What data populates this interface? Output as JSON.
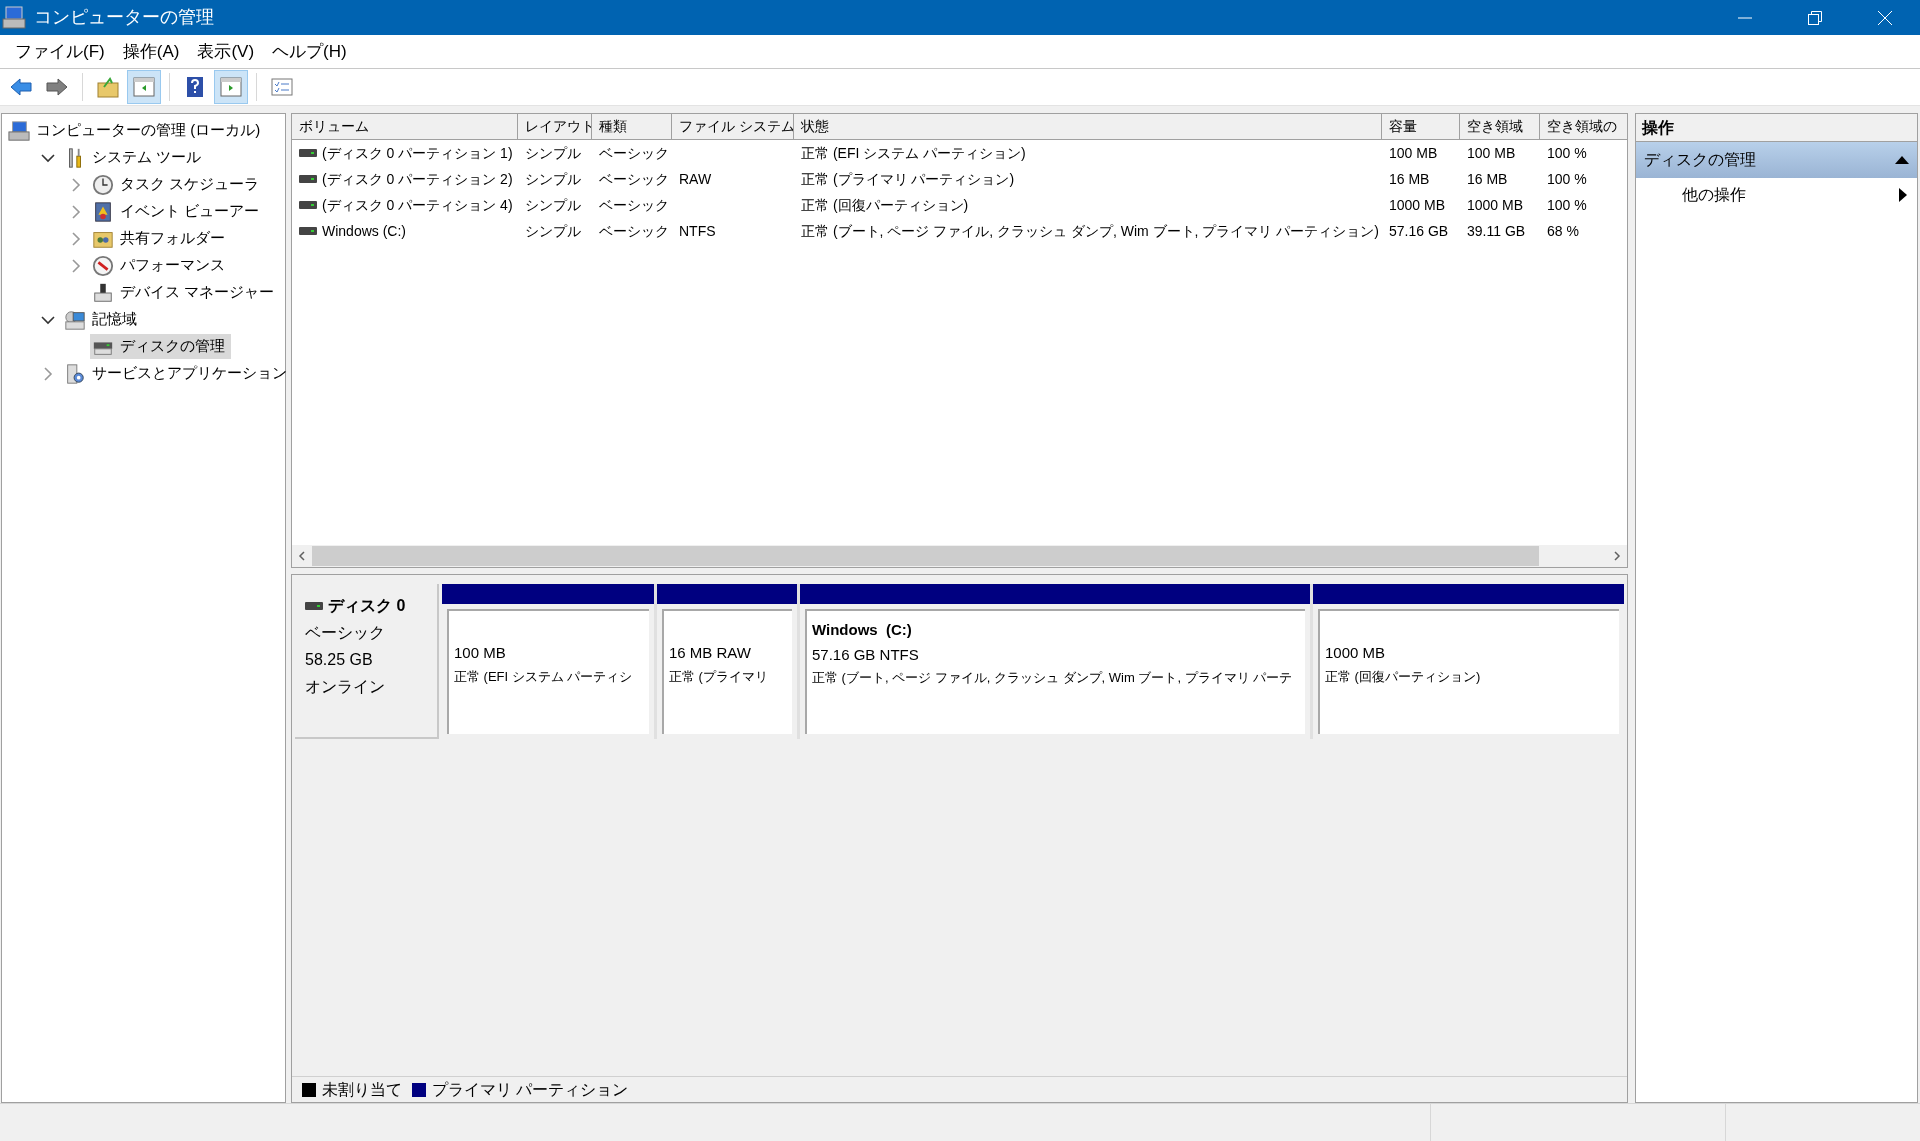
{
  "window": {
    "title": "コンピューターの管理"
  },
  "menu": [
    "ファイル(F)",
    "操作(A)",
    "表示(V)",
    "ヘルプ(H)"
  ],
  "toolbar": [
    {
      "kind": "back",
      "selected": false
    },
    {
      "kind": "forward",
      "selected": false
    },
    {
      "kind": "up",
      "selected": false
    },
    {
      "kind": "tree-pane",
      "selected": true
    },
    {
      "kind": "help",
      "selected": false
    },
    {
      "kind": "action-pane",
      "selected": true
    },
    {
      "kind": "list",
      "selected": false
    }
  ],
  "tree": [
    {
      "label": "コンピューターの管理 (ローカル)",
      "kind": "computer",
      "selected": false,
      "children": [
        {
          "label": "システム ツール",
          "kind": "tools",
          "expanded": true,
          "selected": false,
          "children": [
            {
              "label": "タスク スケジューラ",
              "kind": "clock",
              "expanded": false,
              "selected": false
            },
            {
              "label": "イベント ビューアー",
              "kind": "event",
              "expanded": false,
              "selected": false
            },
            {
              "label": "共有フォルダー",
              "kind": "folder",
              "expanded": false,
              "selected": false
            },
            {
              "label": "パフォーマンス",
              "kind": "performance",
              "expanded": false,
              "selected": false
            },
            {
              "label": "デバイス マネージャー",
              "kind": "device",
              "selected": false
            }
          ]
        },
        {
          "label": "記憶域",
          "kind": "storage",
          "expanded": true,
          "selected": false,
          "children": [
            {
              "label": "ディスクの管理",
              "kind": "disk",
              "selected": true
            }
          ]
        },
        {
          "label": "サービスとアプリケーション",
          "kind": "services",
          "expanded": false,
          "selected": false
        }
      ]
    }
  ],
  "table": {
    "columns": [
      "ボリューム",
      "レイアウト",
      "種類",
      "ファイル システム",
      "状態",
      "容量",
      "空き領域",
      "空き領域の"
    ],
    "rows": [
      [
        "(ディスク 0 パーティション 1)",
        "シンプル",
        "ベーシック",
        "",
        "正常 (EFI システム パーティション)",
        "100 MB",
        "100 MB",
        "100 %"
      ],
      [
        "(ディスク 0 パーティション 2)",
        "シンプル",
        "ベーシック",
        "RAW",
        "正常 (プライマリ パーティション)",
        "16 MB",
        "16 MB",
        "100 %"
      ],
      [
        "(ディスク 0 パーティション 4)",
        "シンプル",
        "ベーシック",
        "",
        "正常 (回復パーティション)",
        "1000 MB",
        "1000 MB",
        "100 %"
      ],
      [
        "Windows (C:)",
        "シンプル",
        "ベーシック",
        "NTFS",
        "正常 (ブート, ページ ファイル, クラッシュ ダンプ, Wim ブート, プライマリ パーティション)",
        "57.16 GB",
        "39.11 GB",
        "68 %"
      ]
    ]
  },
  "disk": {
    "name": "ディスク 0",
    "type": "ベーシック",
    "size": "58.25 GB",
    "status": "オンライン",
    "partitions": [
      {
        "size": "100 MB",
        "status": "正常 (EFI システム パーティシ",
        "color": "#000080"
      },
      {
        "size": "16 MB RAW",
        "status": "正常 (プライマリ",
        "color": "#000080"
      },
      {
        "title": "Windows  (C:)",
        "size": "57.16 GB NTFS",
        "status": "正常 (ブート, ページ ファイル, クラッシュ ダンプ, Wim ブート, プライマリ パーテ",
        "color": "#000080"
      },
      {
        "size": "1000 MB",
        "status": "正常 (回復パーティション)",
        "color": "#000080"
      }
    ]
  },
  "legend": [
    {
      "label": "未割り当て",
      "color": "#000000"
    },
    {
      "label": "プライマリ パーティション",
      "color": "#000080"
    }
  ],
  "actions": {
    "header": "操作",
    "groups": [
      {
        "label": "ディスクの管理",
        "expanded": true,
        "items": [
          "他の操作"
        ]
      }
    ]
  }
}
